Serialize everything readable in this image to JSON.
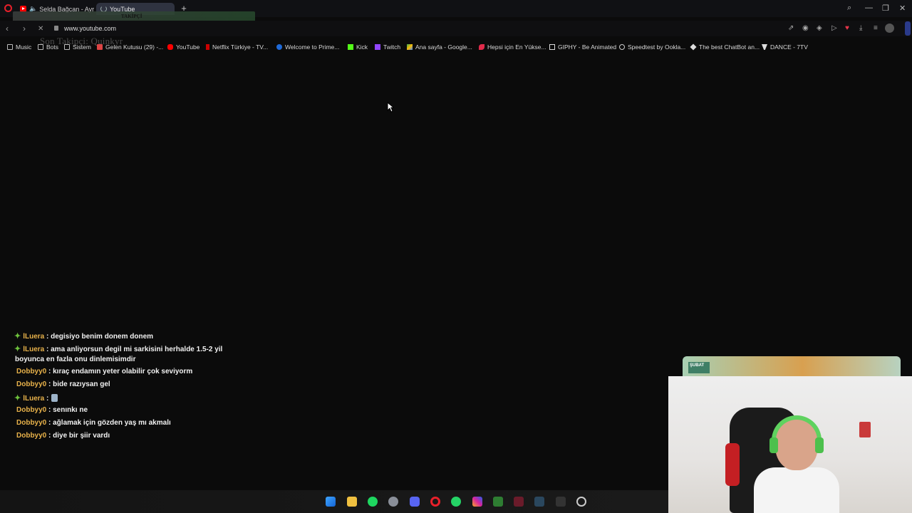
{
  "browser": {
    "tabs": [
      {
        "label": "Selda Bağcan - Ayrılık",
        "active": false
      },
      {
        "label": "YouTube",
        "active": true
      }
    ],
    "url": "www.youtube.com"
  },
  "overlay": {
    "title": "TAKİPÇİ",
    "subtitle": "Son Takipçi: Quinkyr"
  },
  "bookmarks": [
    {
      "label": "Music",
      "icon": "folder-icon"
    },
    {
      "label": "Bots",
      "icon": "folder-icon"
    },
    {
      "label": "Sistem",
      "icon": "folder-icon"
    },
    {
      "label": "Gelen Kutusu (29) -...",
      "icon": "gmail-icon"
    },
    {
      "label": "YouTube",
      "icon": "youtube-icon"
    },
    {
      "label": "Netflix Türkiye - TV...",
      "icon": "netflix-icon"
    },
    {
      "label": "Welcome to Prime...",
      "icon": "prime-icon"
    },
    {
      "label": "Kick",
      "icon": "kick-icon"
    },
    {
      "label": "Twitch",
      "icon": "twitch-icon"
    },
    {
      "label": "Ana sayfa - Google...",
      "icon": "google-drive-icon"
    },
    {
      "label": "Hepsi için En Yükse...",
      "icon": "red-icon"
    },
    {
      "label": "GIPHY - Be Animated",
      "icon": "giphy-icon"
    },
    {
      "label": "Speedtest by Ookla...",
      "icon": "speedtest-icon"
    },
    {
      "label": "The best ChatBot an...",
      "icon": "chatbot-icon"
    },
    {
      "label": "DANCE - 7TV",
      "icon": "7tv-icon"
    }
  ],
  "chat": [
    {
      "user": "lLuera",
      "badge": true,
      "text": "degisiyo benim donem donem"
    },
    {
      "user": "lLuera",
      "badge": true,
      "text": "ama anliyorsun degil mi sarkisini herhalde 1.5-2 yil",
      "cont": "boyunca en fazla onu dinlemisimdir"
    },
    {
      "user": "Dobbyy0",
      "badge": false,
      "text": "kıraç endamın yeter olabilir çok seviyorm"
    },
    {
      "user": "Dobbyy0",
      "badge": false,
      "text": "bide razıysan gel"
    },
    {
      "user": "lLuera",
      "badge": true,
      "text": "",
      "emote": true
    },
    {
      "user": "Dobbyy0",
      "badge": false,
      "text": "senınkı ne"
    },
    {
      "user": "Dobbyy0",
      "badge": false,
      "text": "ağlamak için gözden yaş mı akmalı"
    },
    {
      "user": "Dobbyy0",
      "badge": false,
      "text": "diye bir şiir vardı"
    }
  ],
  "cam": {
    "badge": "ŞUBAT"
  },
  "colors": {
    "background": "#0b0b0b",
    "username": "#e8b24a",
    "badge": "#6ec23c",
    "opera": "#e8202a"
  }
}
